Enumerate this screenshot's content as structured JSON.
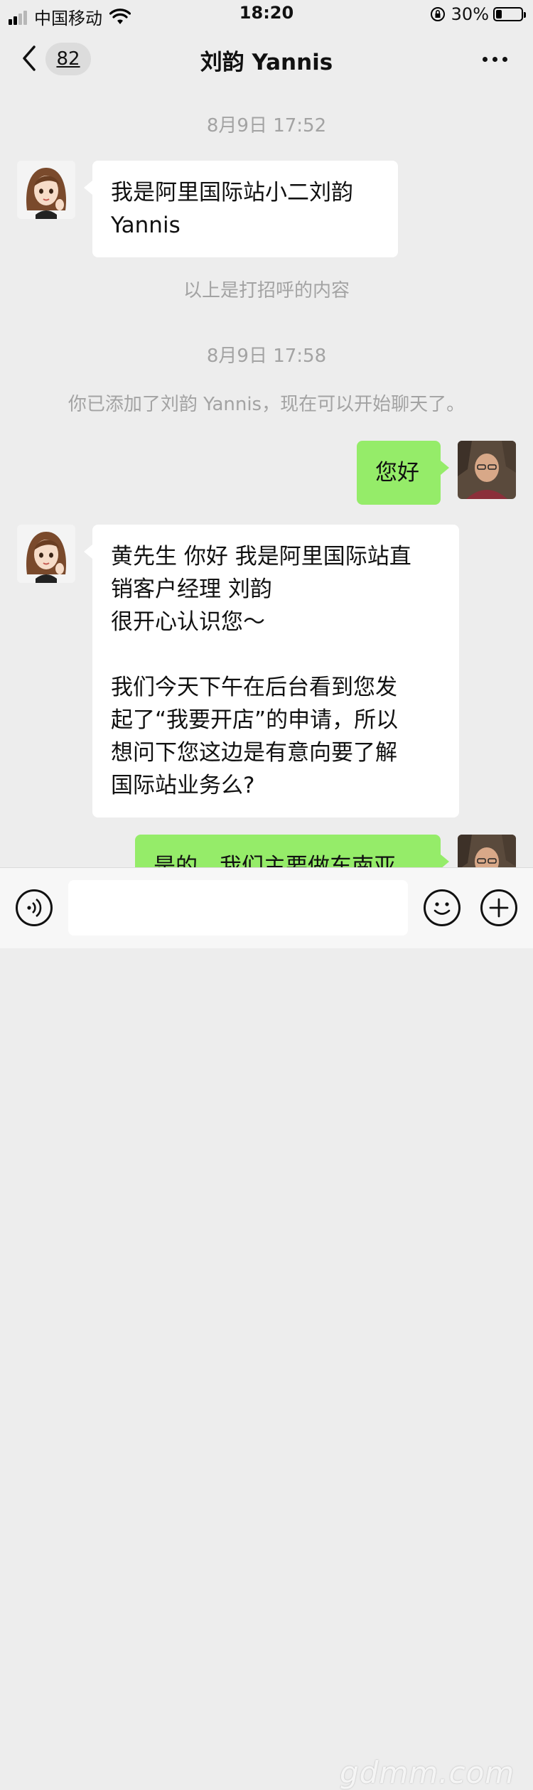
{
  "status_bar": {
    "carrier": "中国移动",
    "time": "18:20",
    "battery_percent": "30%",
    "battery_level": 0.3,
    "signal_bars": 2
  },
  "nav": {
    "unread_count": "82",
    "title": "刘韵 Yannis"
  },
  "messages": {
    "ts1": "8月9日 17:52",
    "greeting": "我是阿里国际站小二刘韵\nYannis",
    "greeting_note": "以上是打招呼的内容",
    "ts2": "8月9日 17:58",
    "added_notice": "你已添加了刘韵 Yannis，现在可以开始聊天了。",
    "hello": "您好",
    "intro": "黄先生 你好 我是阿里国际站直\n销客户经理 刘韵\n很开心认识您～\n\n我们今天下午在后台看到您发\n起了“我要开店”的申请，所以\n想问下您这边是有意向要了解\n国际站业务么?",
    "reply_partial": "是的，我们主要做东南亚"
  },
  "input": {
    "value": ""
  },
  "watermark": "gdmm.com",
  "colors": {
    "background": "#ededed",
    "incoming_bubble": "#ffffff",
    "outgoing_bubble": "#95ec69",
    "system_text": "#a3a3a3"
  },
  "icons": {
    "back": "chevron-left-icon",
    "more": "more-dots-icon",
    "voice": "voice-icon",
    "emoji": "emoji-icon",
    "plus": "plus-icon",
    "wifi": "wifi-icon",
    "lock": "rotation-lock-icon"
  }
}
